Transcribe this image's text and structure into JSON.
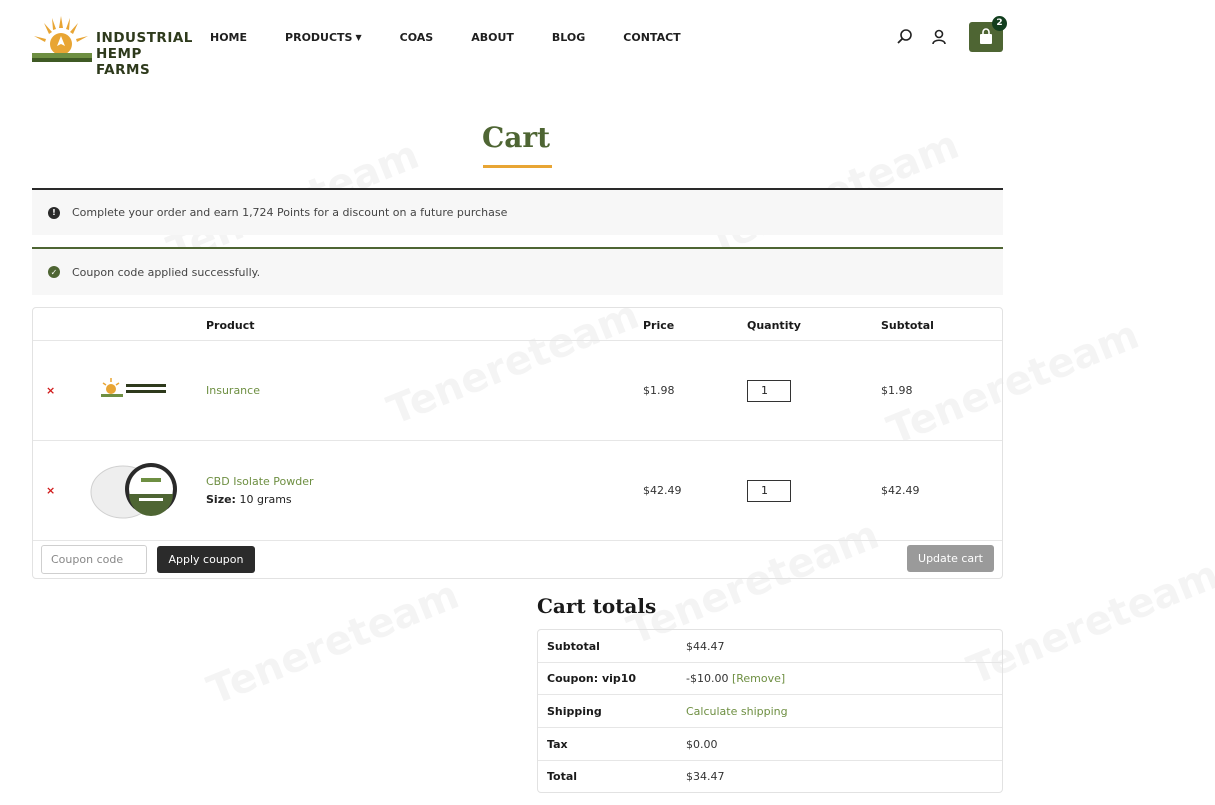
{
  "header": {
    "logo_line1": "INDUSTRIAL",
    "logo_line2": "HEMP FARMS",
    "nav": [
      "HOME",
      "PRODUCTS",
      "COAS",
      "ABOUT",
      "BLOG",
      "CONTACT"
    ],
    "cart_count": "2",
    "icons": [
      "search-icon",
      "user-icon",
      "shopping-bag-icon"
    ]
  },
  "page": {
    "title": "Cart"
  },
  "notices": {
    "info": "Complete your order and earn 1,724 Points for a discount on a future purchase",
    "success": "Coupon code applied successfully."
  },
  "table": {
    "headers": {
      "product": "Product",
      "price": "Price",
      "quantity": "Quantity",
      "subtotal": "Subtotal"
    },
    "rows": [
      {
        "remove": "×",
        "name": "Insurance",
        "price": "$1.98",
        "qty": "1",
        "subtotal": "$1.98"
      },
      {
        "remove": "×",
        "name": "CBD Isolate Powder",
        "meta_label": "Size:",
        "meta_value": "10 grams",
        "price": "$42.49",
        "qty": "1",
        "subtotal": "$42.49"
      }
    ],
    "coupon_placeholder": "Coupon code",
    "apply_label": "Apply coupon",
    "update_label": "Update cart"
  },
  "totals": {
    "title": "Cart totals",
    "subtotal_label": "Subtotal",
    "subtotal_value": "$44.47",
    "coupon_label": "Coupon: vip10",
    "coupon_value": "-$10.00",
    "coupon_remove": "[Remove]",
    "shipping_label": "Shipping",
    "shipping_value": "Calculate shipping",
    "tax_label": "Tax",
    "tax_value": "$0.00",
    "total_label": "Total",
    "total_value": "$34.47"
  },
  "watermark": "Tenereteam",
  "colors": {
    "brand_green": "#4e6533",
    "link_green": "#6e8f42",
    "accent_gold": "#e8a534",
    "remove_red": "#d01919"
  }
}
